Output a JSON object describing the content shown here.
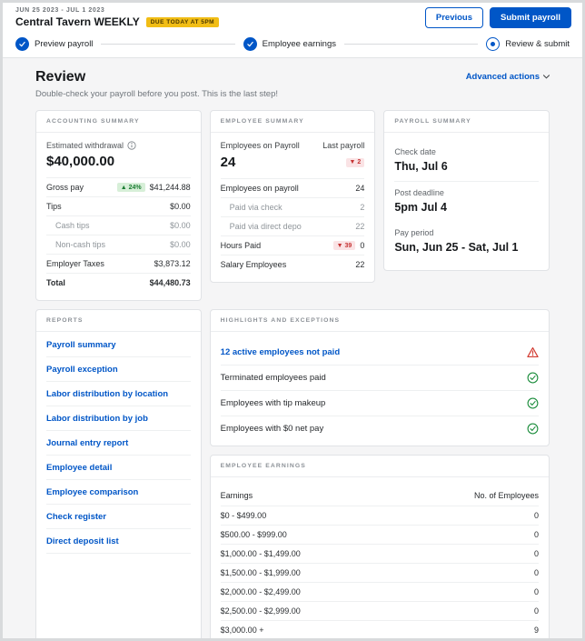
{
  "colors": {
    "accent": "#0056c7",
    "success": "#1e8e3e",
    "danger": "#d23c32",
    "warning_badge_bg": "#f1bd15",
    "warning_badge_text": "#4a3600",
    "badge_up_bg": "#d7efd8",
    "badge_up_text": "#1c7d33",
    "badge_down_bg": "#fae3e5",
    "badge_down_text": "#c63333"
  },
  "header": {
    "date_range": "JUN 25 2023 - JUL 1 2023",
    "title": "Central Tavern WEEKLY",
    "due_badge": "DUE TODAY AT 5PM",
    "previous_label": "Previous",
    "submit_label": "Submit payroll"
  },
  "stepper": {
    "steps": [
      {
        "label": "Preview payroll",
        "state": "complete"
      },
      {
        "label": "Employee earnings",
        "state": "complete"
      },
      {
        "label": "Review & submit",
        "state": "current"
      }
    ]
  },
  "page": {
    "title": "Review",
    "subtitle": "Double-check your payroll before you post. This is the last step!",
    "advanced_actions": "Advanced actions"
  },
  "accounting_summary": {
    "header": "Accounting summary",
    "estimated_withdrawal_label": "Estimated withdrawal",
    "estimated_withdrawal_value": "$40,000.00",
    "rows": [
      {
        "label": "Gross pay",
        "badge": "▲ 24%",
        "value": "$41,244.88"
      },
      {
        "label": "Tips",
        "value": "$0.00"
      },
      {
        "label": "Cash tips",
        "value": "$0.00",
        "indent": true
      },
      {
        "label": "Non-cash tips",
        "value": "$0.00",
        "indent": true
      },
      {
        "label": "Employer Taxes",
        "value": "$3,873.12"
      },
      {
        "label": "Total",
        "value": "$44,480.73",
        "bold": true
      }
    ]
  },
  "employee_summary": {
    "header": "Employee summary",
    "col1": "Employees on Payroll",
    "col2": "Last payroll",
    "count": "24",
    "delta_badge": "▼ 2",
    "rows": [
      {
        "label": "Employees on payroll",
        "value": "24"
      },
      {
        "label": "Paid via check",
        "value": "2",
        "indent": true
      },
      {
        "label": "Paid via direct depo",
        "value": "22",
        "indent": true
      },
      {
        "label": "Hours Paid",
        "badge": "▼ 39",
        "value": "0"
      },
      {
        "label": "Salary Employees",
        "value": "22"
      }
    ]
  },
  "payroll_summary": {
    "header": "Payroll summary",
    "items": [
      {
        "label": "Check date",
        "value": "Thu, Jul 6"
      },
      {
        "label": "Post deadline",
        "value": "5pm Jul 4"
      },
      {
        "label": "Pay period",
        "value": "Sun, Jun 25 - Sat, Jul 1"
      }
    ]
  },
  "reports": {
    "header": "Reports",
    "links": [
      "Payroll summary",
      "Payroll exception",
      "Labor distribution by location",
      "Labor distribution by job",
      "Journal entry report",
      "Employee detail",
      "Employee comparison",
      "Check register",
      "Direct deposit list"
    ]
  },
  "highlights": {
    "header": "Highlights and exceptions",
    "items": [
      {
        "label": "12 active employees not paid",
        "status": "warning"
      },
      {
        "label": "Terminated employees paid",
        "status": "ok"
      },
      {
        "label": "Employees with tip makeup",
        "status": "ok"
      },
      {
        "label": "Employees with $0 net pay",
        "status": "ok"
      }
    ]
  },
  "employee_earnings": {
    "header": "Employee earnings",
    "col1": "Earnings",
    "col2": "No. of Employees",
    "rows": [
      {
        "range": "$0 - $499.00",
        "count": "0"
      },
      {
        "range": "$500.00 - $999.00",
        "count": "0"
      },
      {
        "range": "$1,000.00 - $1,499.00",
        "count": "0"
      },
      {
        "range": "$1,500.00 - $1,999.00",
        "count": "0"
      },
      {
        "range": "$2,000.00 - $2,499.00",
        "count": "0"
      },
      {
        "range": "$2,500.00 - $2,999.00",
        "count": "0"
      },
      {
        "range": "$3,000.00 +",
        "count": "9"
      }
    ]
  }
}
